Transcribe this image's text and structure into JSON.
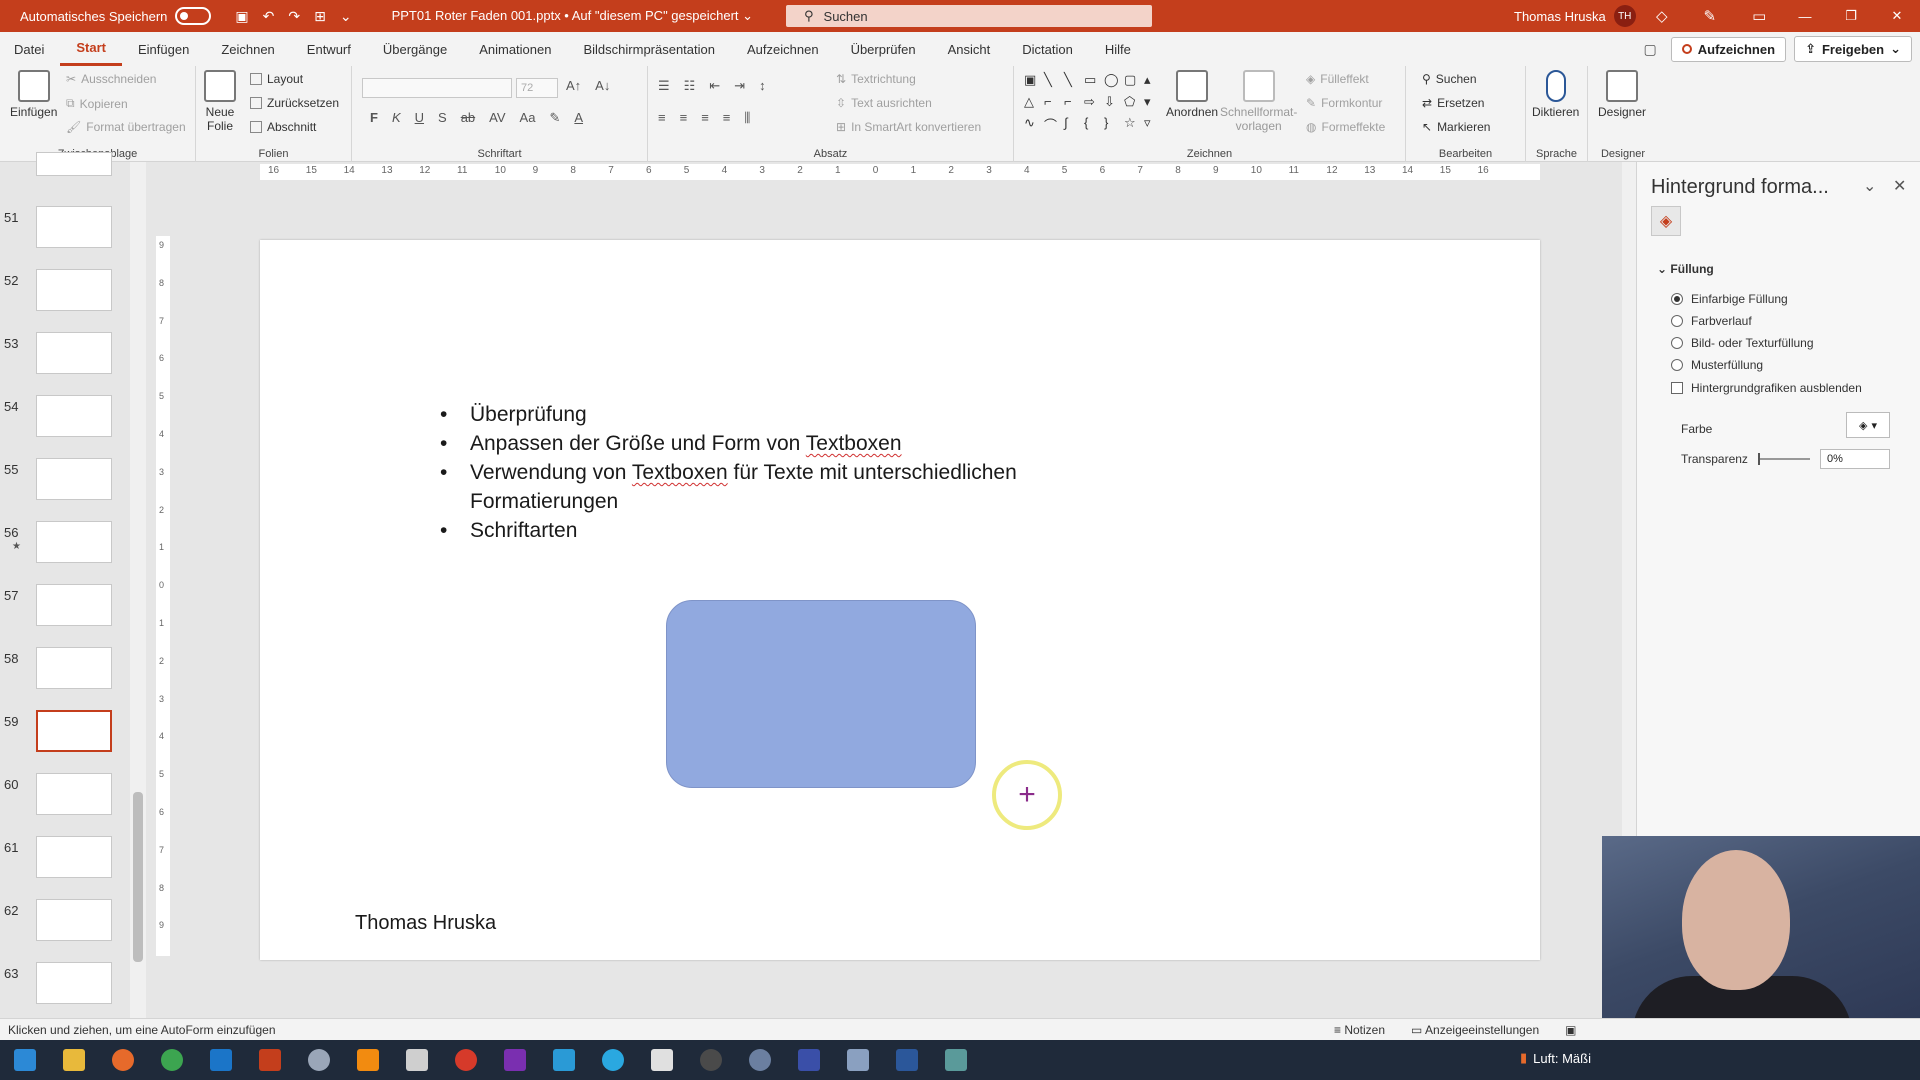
{
  "titlebar": {
    "autosave_label": "Automatisches Speichern",
    "doc_title": "PPT01 Roter Faden 001.pptx • Auf \"diesem PC\" gespeichert ⌄",
    "search_placeholder": "Suchen",
    "user_name": "Thomas Hruska",
    "user_initials": "TH"
  },
  "menu": {
    "tabs": [
      "Datei",
      "Start",
      "Einfügen",
      "Zeichnen",
      "Entwurf",
      "Übergänge",
      "Animationen",
      "Bildschirmpräsentation",
      "Aufzeichnen",
      "Überprüfen",
      "Ansicht",
      "Dictation",
      "Hilfe"
    ],
    "active_tab": "Start",
    "record_label": "Aufzeichnen",
    "share_label": "Freigeben"
  },
  "ribbon": {
    "clipboard": {
      "label": "Zwischenablage",
      "paste": "Einfügen",
      "cut": "Ausschneiden",
      "copy": "Kopieren",
      "format_painter": "Format übertragen"
    },
    "slides": {
      "label": "Folien",
      "new_slide_line1": "Neue",
      "new_slide_line2": "Folie",
      "layout": "Layout",
      "reset": "Zurücksetzen",
      "section": "Abschnitt"
    },
    "font": {
      "label": "Schriftart",
      "size": "72",
      "bold": "F",
      "italic": "K",
      "underline": "U",
      "shadow": "S",
      "strike": "ab",
      "spacing": "AV",
      "case": "Aa"
    },
    "paragraph": {
      "label": "Absatz",
      "text_direction": "Textrichtung",
      "align_text": "Text ausrichten",
      "smartart": "In SmartArt konvertieren"
    },
    "drawing": {
      "label": "Zeichnen",
      "arrange": "Anordnen",
      "quick_styles_line1": "Schnellformat-",
      "quick_styles_line2": "vorlagen",
      "fill": "Fülleffekt",
      "outline": "Formkontur",
      "effects": "Formeffekte"
    },
    "editing": {
      "label": "Bearbeiten",
      "find": "Suchen",
      "replace": "Ersetzen",
      "select": "Markieren"
    },
    "voice": {
      "label": "Sprache",
      "dictate": "Diktieren"
    },
    "designer": {
      "label": "Designer",
      "button": "Designer"
    }
  },
  "thumbnails": [
    {
      "num": "51",
      "star": ""
    },
    {
      "num": "52",
      "star": ""
    },
    {
      "num": "53",
      "star": ""
    },
    {
      "num": "54",
      "star": ""
    },
    {
      "num": "55",
      "star": ""
    },
    {
      "num": "56",
      "star": "★"
    },
    {
      "num": "57",
      "star": ""
    },
    {
      "num": "58",
      "star": ""
    },
    {
      "num": "59",
      "star": ""
    },
    {
      "num": "60",
      "star": ""
    },
    {
      "num": "61",
      "star": ""
    },
    {
      "num": "62",
      "star": ""
    },
    {
      "num": "63",
      "star": ""
    }
  ],
  "active_slide": "59",
  "rulers": {
    "horizontal": [
      "16",
      "15",
      "14",
      "13",
      "12",
      "11",
      "10",
      "9",
      "8",
      "7",
      "6",
      "5",
      "4",
      "3",
      "2",
      "1",
      "0",
      "1",
      "2",
      "3",
      "4",
      "5",
      "6",
      "7",
      "8",
      "9",
      "10",
      "11",
      "12",
      "13",
      "14",
      "15",
      "16"
    ],
    "vertical": [
      "9",
      "8",
      "7",
      "6",
      "5",
      "4",
      "3",
      "2",
      "1",
      "0",
      "1",
      "2",
      "3",
      "4",
      "5",
      "6",
      "7",
      "8",
      "9"
    ]
  },
  "slide": {
    "bullets": [
      "Überprüfung",
      "Anpassen der Größe und Form von Textboxen",
      "Verwendung von Textboxen für Texte mit unterschiedlichen Formatierungen",
      "Schriftarten"
    ],
    "footer": "Thomas Hruska",
    "shape_color": "#91a9df"
  },
  "format_pane": {
    "title": "Hintergrund forma...",
    "section": "Füllung",
    "options": [
      {
        "label": "Einfarbige Füllung",
        "selected": true
      },
      {
        "label": "Farbverlauf",
        "selected": false
      },
      {
        "label": "Bild- oder Texturfüllung",
        "selected": false
      },
      {
        "label": "Musterfüllung",
        "selected": false
      }
    ],
    "hide_graphics": "Hintergrundgrafiken ausblenden",
    "color_label": "Farbe",
    "transparency_label": "Transparenz",
    "transparency_value": "0%"
  },
  "statusbar": {
    "message": "Klicken und ziehen, um eine AutoForm einzufügen",
    "notes": "Notizen",
    "display_settings": "Anzeigeeinstellungen"
  },
  "taskbar": {
    "weather": "Luft: Mäßi"
  },
  "colors": {
    "accent": "#c43e1c",
    "taskbar": "#1f2a3a"
  }
}
